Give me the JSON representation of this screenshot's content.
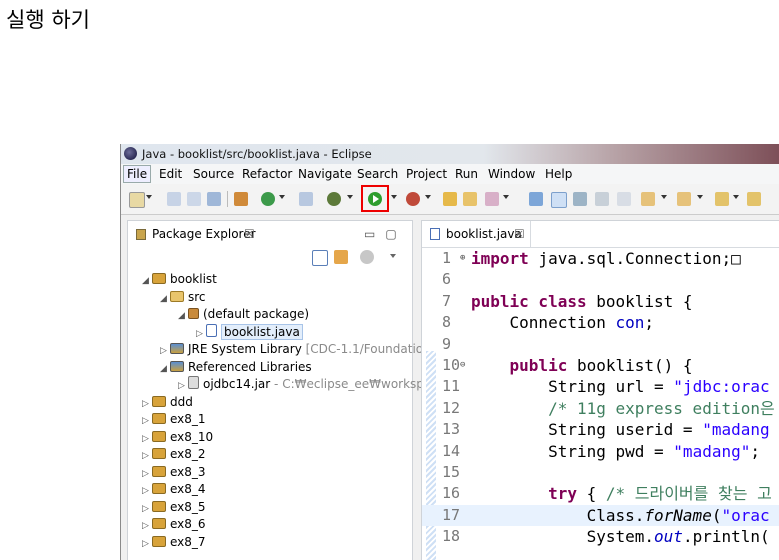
{
  "caption": "실행 하기",
  "window": {
    "title": "Java - booklist/src/booklist.java - Eclipse"
  },
  "menu": [
    "File",
    "Edit",
    "Source",
    "Refactor",
    "Navigate",
    "Search",
    "Project",
    "Run",
    "Window",
    "Help"
  ],
  "package_explorer": {
    "tab_label": "Package Explorer",
    "close": "☒",
    "tree": [
      {
        "arrow": "◢",
        "icon": "proj",
        "label": "booklist"
      },
      {
        "arrow": "◢",
        "icon": "folder",
        "label": "src"
      },
      {
        "arrow": "◢",
        "icon": "pkg",
        "label": "(default package)"
      },
      {
        "arrow": "▷",
        "icon": "jfile",
        "label": "booklist.java"
      },
      {
        "arrow": "▷",
        "icon": "lib",
        "label": "JRE System Library",
        "extra": "[CDC-1.1/Foundation"
      },
      {
        "arrow": "◢",
        "icon": "lib",
        "label": "Referenced Libraries"
      },
      {
        "arrow": "▷",
        "icon": "jar",
        "label": "ojdbc14.jar",
        "extra": "- C:₩eclipse_ee₩workspa"
      },
      {
        "arrow": "▷",
        "icon": "proj",
        "label": "ddd"
      },
      {
        "arrow": "▷",
        "icon": "proj",
        "label": "ex8_1"
      },
      {
        "arrow": "▷",
        "icon": "proj",
        "label": "ex8_10"
      },
      {
        "arrow": "▷",
        "icon": "proj",
        "label": "ex8_2"
      },
      {
        "arrow": "▷",
        "icon": "proj",
        "label": "ex8_3"
      },
      {
        "arrow": "▷",
        "icon": "proj",
        "label": "ex8_4"
      },
      {
        "arrow": "▷",
        "icon": "proj",
        "label": "ex8_5"
      },
      {
        "arrow": "▷",
        "icon": "proj",
        "label": "ex8_6"
      },
      {
        "arrow": "▷",
        "icon": "proj",
        "label": "ex8_7"
      }
    ]
  },
  "editor": {
    "tab_label": "booklist.java",
    "close": "☒",
    "lines": [
      {
        "n": "1",
        "fold": "⊕",
        "code": "import java.sql.Connection;□"
      },
      {
        "n": "6",
        "code": ""
      },
      {
        "n": "7",
        "code": "public class booklist {"
      },
      {
        "n": "8",
        "code": "    Connection con;"
      },
      {
        "n": "9",
        "code": ""
      },
      {
        "n": "10",
        "fold": "⊖",
        "code": "    public booklist() {"
      },
      {
        "n": "11",
        "code": "        String url = \"jdbc:orac"
      },
      {
        "n": "12",
        "code": "        /* 11g express edition은"
      },
      {
        "n": "13",
        "code": "        String userid = \"madang"
      },
      {
        "n": "14",
        "code": "        String pwd = \"madang\";"
      },
      {
        "n": "15",
        "code": ""
      },
      {
        "n": "16",
        "code": "        try { /* 드라이버를 찾는 고"
      },
      {
        "n": "17",
        "code": "            Class.forName(\"orac"
      },
      {
        "n": "18",
        "code": "            System.out.println("
      }
    ]
  }
}
